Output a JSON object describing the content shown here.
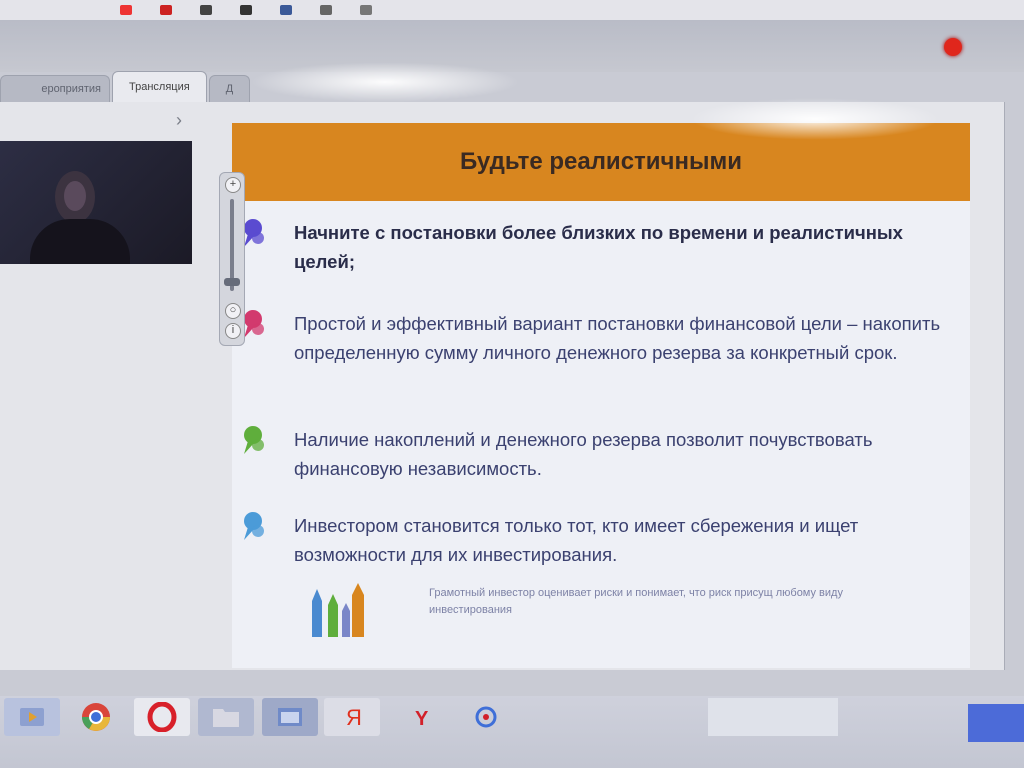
{
  "tabs": [
    {
      "label": "ероприятия"
    },
    {
      "label": "Трансляция"
    },
    {
      "label": "Д"
    }
  ],
  "slide": {
    "title": "Будьте реалистичными",
    "bullets": [
      {
        "text": "Начните с постановки более близких по времени и реалистичных целей;",
        "pin_color": "#5a4bd0"
      },
      {
        "text": "Простой и эффективный вариант постановки финансовой цели – накопить определенную сумму личного денежного резерва за конкретный срок.",
        "pin_color": "#d23a6e"
      },
      {
        "text": "Наличие накоплений и денежного резерва позволит почувствовать финансовую независимость.",
        "pin_color": "#5fae3c"
      },
      {
        "text": "Инвестором становится только тот, кто имеет сбережения и ищет возможности для их инвестирования.",
        "pin_color": "#4b9bd8"
      }
    ],
    "footer_note": "Грамотный инвестор оценивает риски и понимает, что риск присущ любому виду инвестирования"
  },
  "colors": {
    "title_bar": "#d8861f",
    "record": "#e0261c",
    "text": "#3b4170"
  },
  "zoom_level": 0.9
}
